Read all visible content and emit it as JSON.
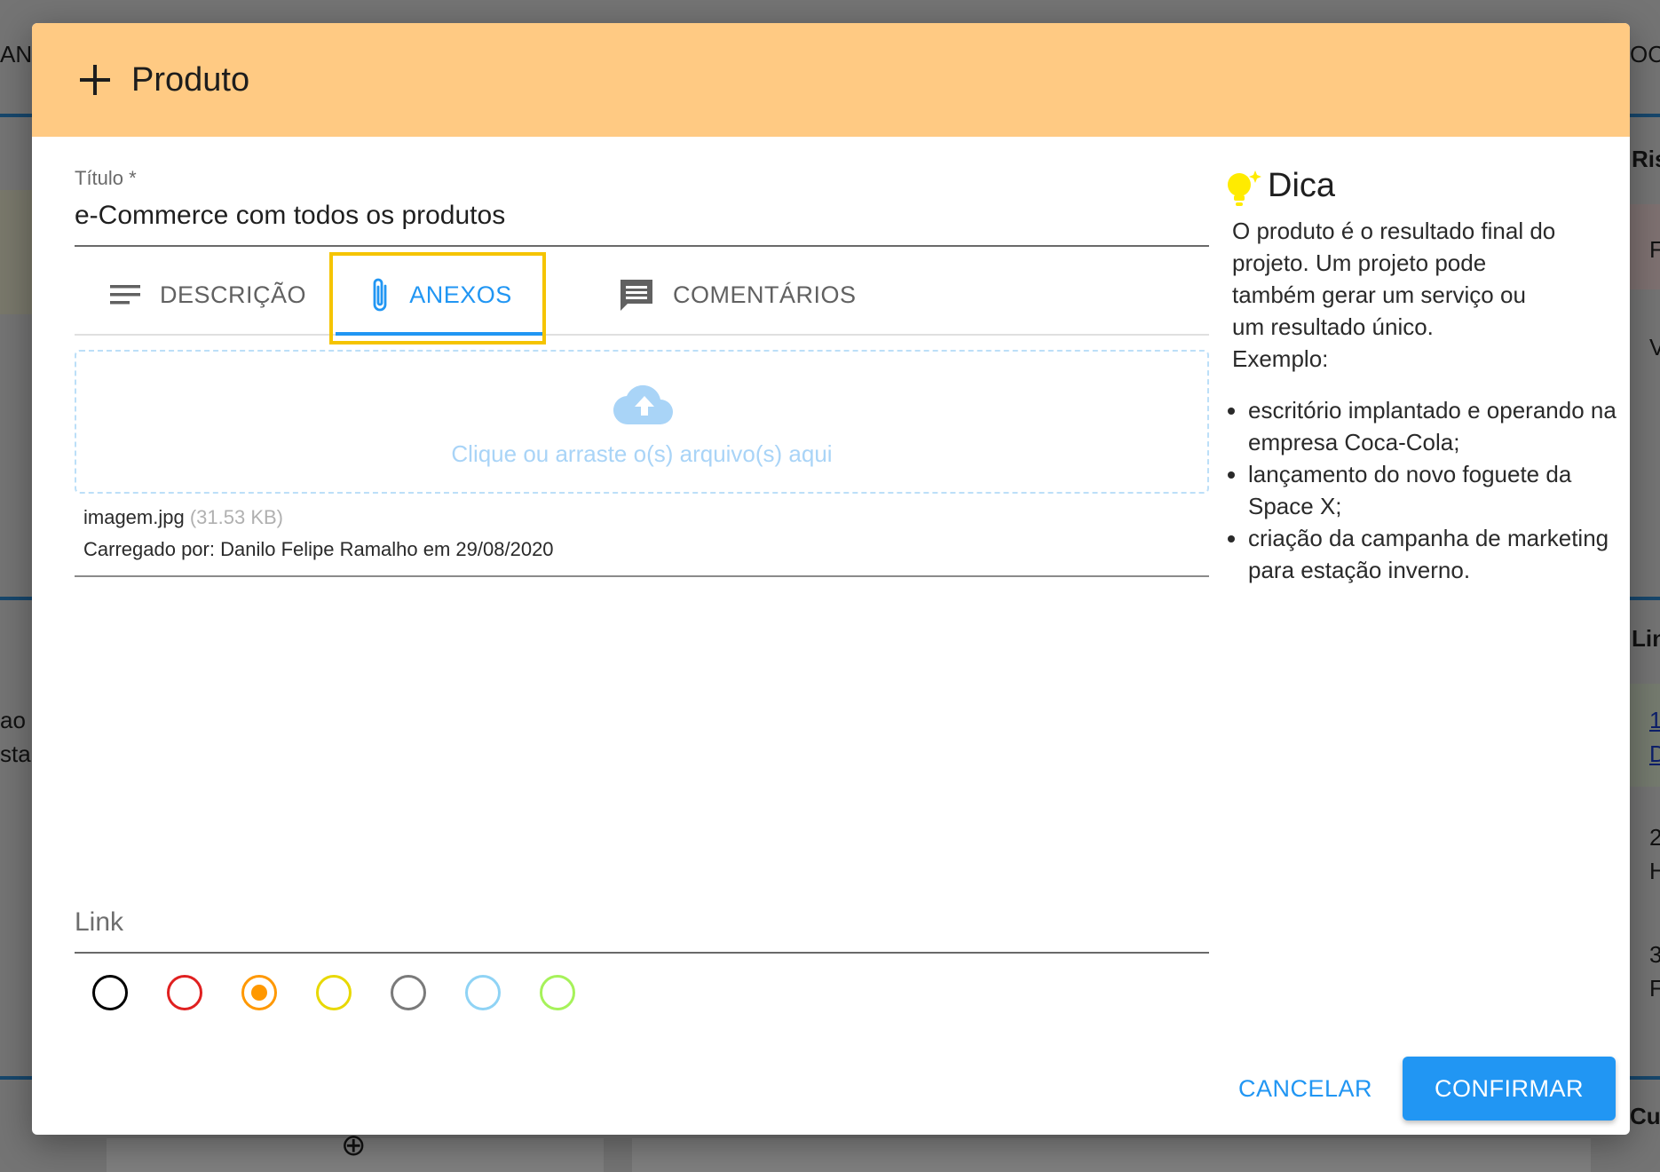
{
  "background": {
    "left_fragments": [
      "AN",
      "ao",
      "sta"
    ],
    "right_fragments": [
      "OC",
      "Ris",
      "F",
      "V",
      "Lin",
      "1",
      "D",
      "2",
      "H",
      "3",
      "F",
      "Cu"
    ],
    "bottom_add_symbol": "⊕"
  },
  "dialog": {
    "title": "Produto",
    "header_color": "#ffca83",
    "form": {
      "title_label": "Título *",
      "title_value": "e-Commerce com todos os produtos",
      "tabs": [
        {
          "label": "DESCRIÇÃO",
          "icon": "notes-icon",
          "active": false
        },
        {
          "label": "ANEXOS",
          "icon": "paperclip-icon",
          "active": true
        },
        {
          "label": "COMENTÁRIOS",
          "icon": "comment-icon",
          "active": false
        }
      ],
      "dropzone_text": "Clique ou arraste o(s) arquivo(s) aqui",
      "attachment": {
        "name": "imagem.jpg",
        "size": "(31.53 KB)",
        "uploaded_by": "Carregado por: Danilo Felipe Ramalho em 29/08/2020"
      },
      "link_label": "Link",
      "color_options": [
        {
          "color": "#000000",
          "selected": false
        },
        {
          "color": "#e02020",
          "selected": false
        },
        {
          "color": "#ff9800",
          "selected": true
        },
        {
          "color": "#e8d800",
          "selected": false
        },
        {
          "color": "#7a7a7a",
          "selected": false
        },
        {
          "color": "#8fd3f5",
          "selected": false
        },
        {
          "color": "#a6f25a",
          "selected": false
        }
      ]
    },
    "tip": {
      "title": "Dica",
      "body_lines": [
        "O produto é o resultado final do",
        "projeto. Um projeto pode",
        "também gerar um serviço ou",
        "um resultado único.",
        "Exemplo:"
      ],
      "examples": [
        "escritório implantado e operando na empresa Coca-Cola;",
        "lançamento do novo foguete da Space X;",
        "criação da campanha de marketing para estação inverno."
      ]
    },
    "actions": {
      "cancel_label": "CANCELAR",
      "confirm_label": "CONFIRMAR"
    },
    "accent_color": "#2196f3"
  }
}
